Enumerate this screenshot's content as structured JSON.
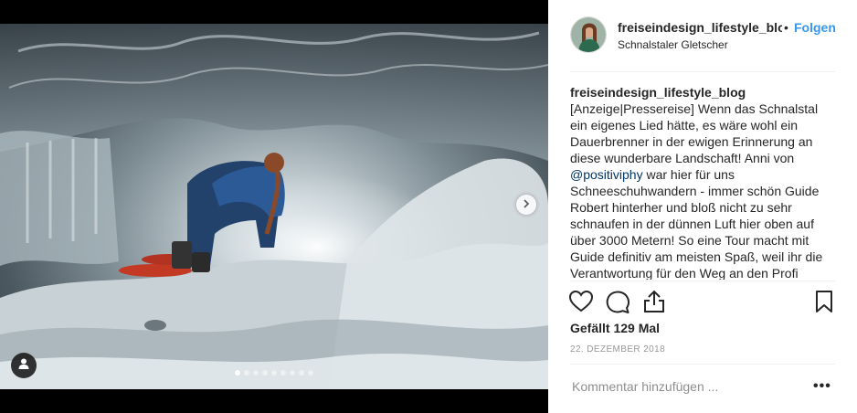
{
  "post": {
    "username": "freiseindesign_lifestyle_blog",
    "bullet": "•",
    "follow_label": "Folgen",
    "location": "Schnalstaler Gletscher",
    "caption": {
      "user": "freiseindesign_lifestyle_blog",
      "text_before": " [Anzeige|Pressereise] Wenn das Schnalstal ein eigenes Lied hätte, es wäre wohl ein Dauerbrenner in der ewigen Erinnerung an diese wunderbare Landschaft! Anni von ",
      "mention": "@positiviphy",
      "text_after": " war hier für uns Schneeschuhwandern - immer schön Guide Robert hinterher und bloß nicht zu sehr schnaufen in der dünnen Luft hier oben auf über 3000 Metern! So eine Tour macht mit Guide definitiv am meisten Spaß, weil ihr die Verantwortung für den Weg an den Profi abgeben könnt und auch"
    },
    "likes": "Gefällt 129 Mal",
    "date": "22. DEZEMBER 2018",
    "comment_placeholder": "Kommentar hinzufügen ...",
    "more_label": "•••"
  },
  "media": {
    "carousel_count": 9,
    "carousel_active_index": 0,
    "icons": [
      "chevron-right-icon",
      "user-icon"
    ]
  },
  "colors": {
    "accent": "#3897f0",
    "mention": "#003569",
    "text": "#262626",
    "muted": "#999999"
  }
}
